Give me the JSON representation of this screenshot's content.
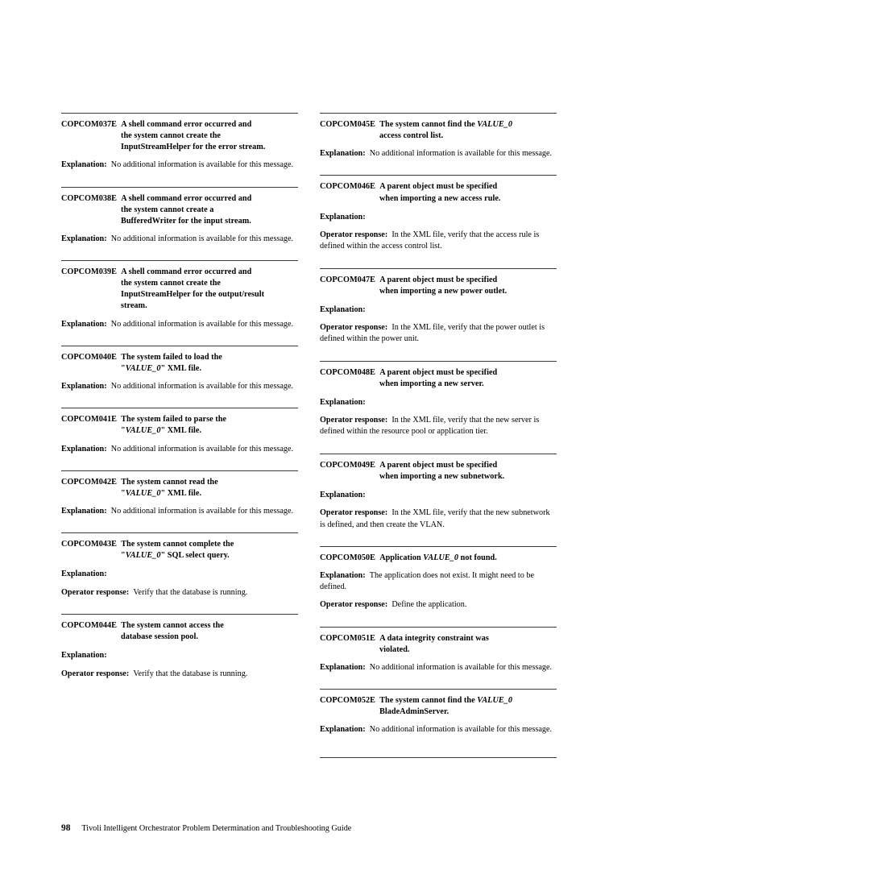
{
  "page": {
    "background_color": "#ffffff",
    "rule_color": "#3a3a3a",
    "text_color": "#000000"
  },
  "footer": {
    "page_number": "98",
    "book_title": "Tivoli Intelligent Orchestrator Problem Determination and Troubleshooting Guide"
  },
  "columns": {
    "left": {
      "entries": [
        {
          "id": "COPCOM037E",
          "title_line1": "A shell command error occurred and",
          "title_line2": "the system cannot create the",
          "title_line3": "InputStreamHelper for the error stream.",
          "explanation_label": "Explanation:",
          "explanation_text": "No additional information is available for this message."
        },
        {
          "id": "COPCOM038E",
          "title_line1": "A shell command error occurred and",
          "title_line2": "the system cannot create a",
          "title_line3": "BufferedWriter for the input stream.",
          "explanation_label": "Explanation:",
          "explanation_text": "No additional information is available for this message."
        },
        {
          "id": "COPCOM039E",
          "title_line1": "A shell command error occurred and",
          "title_line2": "the system cannot create the",
          "title_line3": "InputStreamHelper for the output/result",
          "title_line4": "stream.",
          "explanation_label": "Explanation:",
          "explanation_text": "No additional information is available for this message."
        },
        {
          "id": "COPCOM040E",
          "title_line1": "The system failed to load the",
          "title_line2_pre": "\"",
          "title_line2_value": "VALUE_0",
          "title_line2_post": "\" XML file.",
          "explanation_label": "Explanation:",
          "explanation_text": "No additional information is available for this message."
        },
        {
          "id": "COPCOM041E",
          "title_line1": "The system failed to parse the",
          "title_line2_pre": "\"",
          "title_line2_value": "VALUE_0",
          "title_line2_post": "\" XML file.",
          "explanation_label": "Explanation:",
          "explanation_text": "No additional information is available for this message."
        },
        {
          "id": "COPCOM042E",
          "title_line1": "The system cannot read the",
          "title_line2_pre": "\"",
          "title_line2_value": "VALUE_0",
          "title_line2_post": "\" XML file.",
          "explanation_label": "Explanation:",
          "explanation_text": "No additional information is available for this message."
        },
        {
          "id": "COPCOM043E",
          "title_line1": "The system cannot complete the",
          "title_line2_pre": "\"",
          "title_line2_value": "VALUE_0",
          "title_line2_post": "\" SQL select query.",
          "explanation_label": "Explanation:",
          "explanation_text": "",
          "operator_label": "Operator response:",
          "operator_text": "Verify that the database is running."
        },
        {
          "id": "COPCOM044E",
          "title_line1": "The system cannot access the",
          "title_line2": "database session pool.",
          "explanation_label": "Explanation:",
          "explanation_text": "",
          "operator_label": "Operator response:",
          "operator_text": "Verify that the database is running."
        }
      ]
    },
    "right": {
      "entries": [
        {
          "id": "COPCOM045E",
          "title_line1_pre": "The system cannot find the ",
          "title_line1_value": "VALUE_0",
          "title_line2": "access control list.",
          "explanation_label": "Explanation:",
          "explanation_text": "No additional information is available for this message."
        },
        {
          "id": "COPCOM046E",
          "title_line1": "A parent object must be specified",
          "title_line2": "when importing a new access rule.",
          "explanation_label": "Explanation:",
          "explanation_text": "",
          "operator_label": "Operator response:",
          "operator_text": "In the XML file, verify that the access rule is defined within the access control list."
        },
        {
          "id": "COPCOM047E",
          "title_line1": "A parent object must be specified",
          "title_line2": "when importing a new power outlet.",
          "explanation_label": "Explanation:",
          "explanation_text": "",
          "operator_label": "Operator response:",
          "operator_text": "In the XML file, verify that the power outlet is defined within the power unit."
        },
        {
          "id": "COPCOM048E",
          "title_line1": "A parent object must be specified",
          "title_line2": "when importing a new server.",
          "explanation_label": "Explanation:",
          "explanation_text": "",
          "operator_label": "Operator response:",
          "operator_text": "In the XML file, verify that the new server is defined within the resource pool or application tier."
        },
        {
          "id": "COPCOM049E",
          "title_line1": "A parent object must be specified",
          "title_line2": "when importing a new subnetwork.",
          "explanation_label": "Explanation:",
          "explanation_text": "",
          "operator_label": "Operator response:",
          "operator_text": "In the XML file, verify that the new subnetwork is defined, and then create the VLAN."
        },
        {
          "id": "COPCOM050E",
          "title_line1_pre": "Application ",
          "title_line1_value": "VALUE_0",
          "title_line1_post": " not found.",
          "explanation_label": "Explanation:",
          "explanation_text": "The application does not exist. It might need to be defined.",
          "operator_label": "Operator response:",
          "operator_text": "Define the application."
        },
        {
          "id": "COPCOM051E",
          "title_line1": "A data integrity constraint was",
          "title_line2": "violated.",
          "explanation_label": "Explanation:",
          "explanation_text": "No additional information is available for this message."
        },
        {
          "id": "COPCOM052E",
          "title_line1_pre": "The system cannot find the ",
          "title_line1_value": "VALUE_0",
          "title_line2": "BladeAdminServer.",
          "explanation_label": "Explanation:",
          "explanation_text": "No additional information is available for this message."
        }
      ]
    }
  }
}
